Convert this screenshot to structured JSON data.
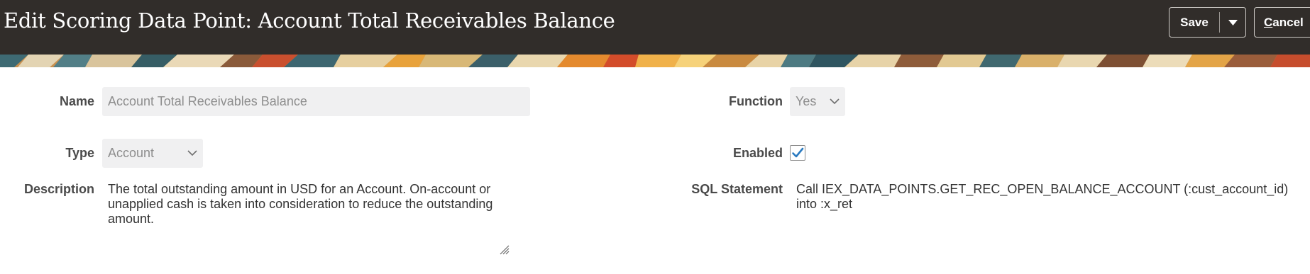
{
  "header": {
    "title": "Edit Scoring Data Point: Account Total Receivables Balance",
    "save_label": "Save",
    "cancel_first": "C",
    "cancel_rest": "ancel"
  },
  "form": {
    "name": {
      "label": "Name",
      "value": "Account Total Receivables Balance"
    },
    "type": {
      "label": "Type",
      "value": "Account"
    },
    "description": {
      "label": "Description",
      "value": "The total outstanding amount in USD for an Account. On-account or unapplied cash is taken into consideration to reduce the outstanding amount."
    },
    "function": {
      "label": "Function",
      "value": "Yes"
    },
    "enabled": {
      "label": "Enabled",
      "checked": true
    },
    "sql": {
      "label": "SQL Statement",
      "value": "Call IEX_DATA_POINTS.GET_REC_OPEN_BALANCE_ACCOUNT (:cust_account_id) into :x_ret"
    }
  },
  "icons": {
    "save_menu": "chevron-down-icon",
    "select": "chevron-down-icon",
    "checkbox": "checkmark-icon",
    "resize": "resize-handle-icon"
  },
  "colors": {
    "header_bg": "#312d2a",
    "field_bg": "#f0f0f1",
    "check_blue": "#2a7ac0"
  }
}
